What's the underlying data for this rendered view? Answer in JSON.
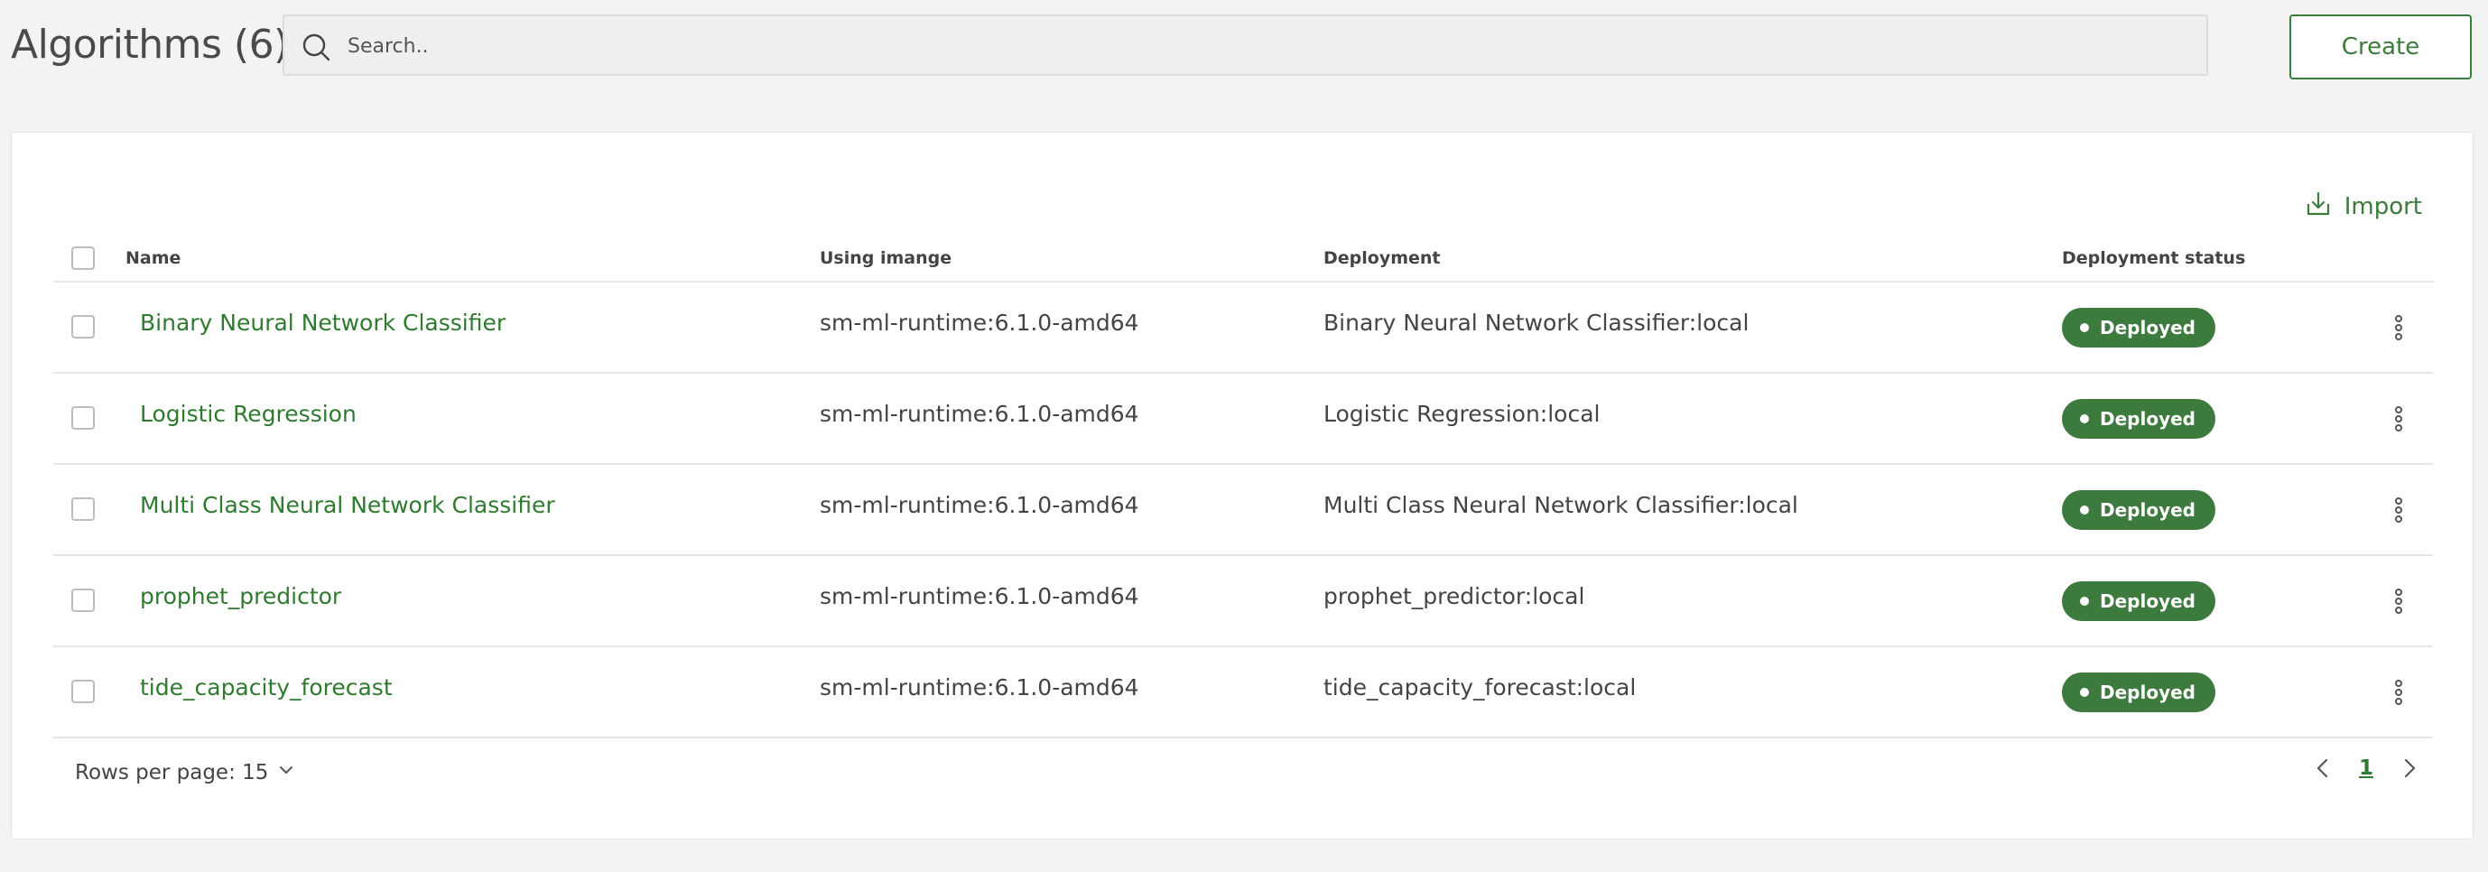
{
  "header": {
    "title": "Algorithms (6)",
    "search_placeholder": "Search..",
    "search_value": "",
    "create_label": "Create"
  },
  "toolbar": {
    "import_label": "Import"
  },
  "table": {
    "columns": {
      "name": "Name",
      "image": "Using imange",
      "deployment": "Deployment",
      "status": "Deployment status"
    },
    "rows": [
      {
        "name": "Binary Neural Network Classifier",
        "image": "sm-ml-runtime:6.1.0-amd64",
        "deployment": "Binary Neural Network Classifier:local",
        "status": "Deployed"
      },
      {
        "name": "Logistic Regression",
        "image": "sm-ml-runtime:6.1.0-amd64",
        "deployment": "Logistic Regression:local",
        "status": "Deployed"
      },
      {
        "name": "Multi Class Neural Network Classifier",
        "image": "sm-ml-runtime:6.1.0-amd64",
        "deployment": "Multi Class Neural Network Classifier:local",
        "status": "Deployed"
      },
      {
        "name": "prophet_predictor",
        "image": "sm-ml-runtime:6.1.0-amd64",
        "deployment": "prophet_predictor:local",
        "status": "Deployed"
      },
      {
        "name": "tide_capacity_forecast",
        "image": "sm-ml-runtime:6.1.0-amd64",
        "deployment": "tide_capacity_forecast:local",
        "status": "Deployed"
      }
    ]
  },
  "pagination": {
    "rows_per_page_label": "Rows per page: 15",
    "current_page": "1"
  },
  "colors": {
    "accent": "#3d7a3d",
    "link": "#2f7a2f",
    "background": "#f3f3f4"
  },
  "icons": {
    "search": "search-icon",
    "import": "import-icon",
    "row_menu": "kebab-menu-icon",
    "dropdown": "chevron-down-icon",
    "prev": "chevron-left-icon",
    "next": "chevron-right-icon"
  }
}
